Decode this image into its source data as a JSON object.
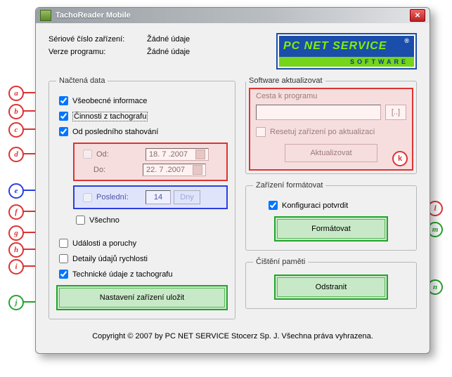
{
  "window": {
    "title": "TachoReader Mobile"
  },
  "info": {
    "serial_label": "Sériové číslo zařízení:",
    "serial_value": "Žádné údaje",
    "version_label": "Verze programu:",
    "version_value": "Žádné údaje"
  },
  "logo": {
    "brand": "PC NET SERVICE",
    "sub": "SOFTWARE"
  },
  "left": {
    "legend": "Načtená data",
    "checks": {
      "a": {
        "label": "Všeobecné informace",
        "checked": true
      },
      "b": {
        "label": "Činnosti z tachografu",
        "checked": true
      },
      "c": {
        "label": "Od posledního stahování",
        "checked": true
      },
      "od": {
        "enabled": false,
        "od_label": "Od:",
        "od_value": "18. 7 .2007",
        "do_label": "Do:",
        "do_value": "22. 7 .2007"
      },
      "posl": {
        "enabled": false,
        "label": "Poslední:",
        "value": "14",
        "unit": "Dny"
      },
      "f": {
        "label": "Všechno",
        "checked": false
      },
      "g": {
        "label": "Události a poruchy",
        "checked": false
      },
      "h": {
        "label": "Detaily údajů rychlosti",
        "checked": false
      },
      "i": {
        "label": "Technické údaje z tachografu",
        "checked": true
      }
    },
    "save_button": "Nastavení zařízení uložit"
  },
  "right": {
    "sw": {
      "legend": "Software aktualizovat",
      "path_label": "Cesta k programu",
      "browse": "[..]",
      "reset_label": "Resetuj zařízení po aktualizaci",
      "button": "Aktualizovat"
    },
    "format": {
      "legend": "Zařízení formátovat",
      "confirm_label": "Konfiguraci potvrdit",
      "confirm_checked": true,
      "button": "Formátovat"
    },
    "clear": {
      "legend": "Čištění paměti",
      "button": "Odstranit"
    }
  },
  "copyright": "Copyright © 2007 by PC NET SERVICE Stocerz Sp. J. Všechna práva vyhrazena.",
  "markers": {
    "a": "a",
    "b": "b",
    "c": "c",
    "d": "d",
    "e": "e",
    "f": "f",
    "g": "g",
    "h": "h",
    "i": "i",
    "j": "j",
    "k": "k",
    "l": "l",
    "m": "m",
    "n": "n"
  }
}
